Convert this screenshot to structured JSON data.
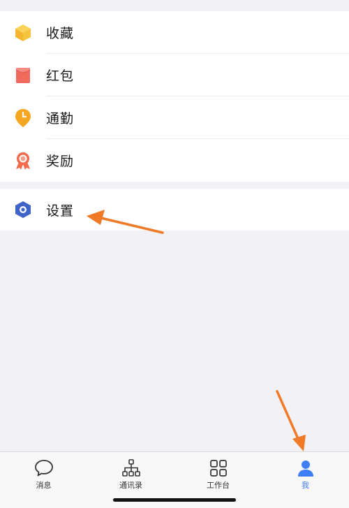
{
  "menu_group_1": {
    "items": [
      {
        "key": "favorites",
        "label": "收藏",
        "icon": "favorites-box-icon",
        "icon_color": "#f7c33c"
      },
      {
        "key": "red-packet",
        "label": "红包",
        "icon": "red-packet-icon",
        "icon_color": "#f06a5e"
      },
      {
        "key": "commute",
        "label": "通勤",
        "icon": "commute-clock-pin-icon",
        "icon_color": "#f5a623"
      },
      {
        "key": "reward",
        "label": "奖励",
        "icon": "reward-medal-icon",
        "icon_color": "#f06a4b"
      }
    ]
  },
  "menu_group_2": {
    "items": [
      {
        "key": "settings",
        "label": "设置",
        "icon": "settings-hexagon-icon",
        "icon_color": "#3f64c8"
      }
    ]
  },
  "tabbar": {
    "tabs": [
      {
        "label": "消息",
        "icon": "message-bubble-icon",
        "active": false
      },
      {
        "label": "通讯录",
        "icon": "org-chart-icon",
        "active": false
      },
      {
        "label": "工作台",
        "icon": "grid-icon",
        "active": false
      },
      {
        "label": "我",
        "icon": "person-icon",
        "active": true
      }
    ]
  },
  "colors": {
    "background": "#f2f2f6",
    "active_tab": "#3f7ef5",
    "annotation_arrow": "#f07a28"
  }
}
